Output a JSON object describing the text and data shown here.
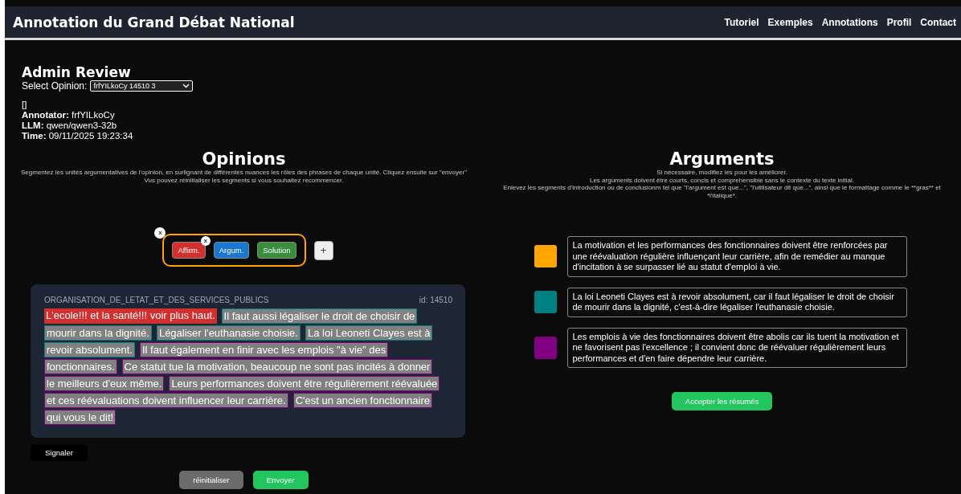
{
  "header": {
    "title": "Annotation du Grand Débat National",
    "nav": [
      "Tutoriel",
      "Exemples",
      "Annotations",
      "Profil",
      "Contact"
    ]
  },
  "review": {
    "title": "Admin Review",
    "select_label": "Select Opinion:",
    "select_value": "frfYILkoCy 14510 3",
    "raw": "[]",
    "meta": [
      {
        "label": "Annotator:",
        "value": "frfYILkoCy"
      },
      {
        "label": "LLM:",
        "value": "qwen/qwen3-32b"
      },
      {
        "label": "Time:",
        "value": "09/11/2025 19:23:34"
      }
    ]
  },
  "opinions": {
    "title": "Opinions",
    "instructions": [
      "Segmentez les unités argumentatives de l'opinion, en surlignant de différentes nuances les rôles des phrases de chaque unité. Cliquez ensuite sur \"envoyer\"",
      "Vus pouvez réinitialiser les segments si vous souhaitez recommencer."
    ],
    "group_remove": "x",
    "chips": [
      {
        "label": "Affirm.",
        "color": "#d32f2f",
        "remove": "x"
      },
      {
        "label": "Argum.",
        "color": "#1976d2"
      },
      {
        "label": "Solution",
        "color": "#388e3c"
      }
    ],
    "add": "+",
    "card": {
      "category": "ORGANISATION_DE_LETAT_ET_DES_SERVICES_PUBLICS",
      "id": "id: 14510",
      "segments": [
        {
          "lines": [
            "L'ecole!!! et la santé!!! voir plus haut."
          ],
          "kind": "filled",
          "color": "#d32f2f"
        },
        {
          "lines": [
            "Il faut aussi légaliser le droit de choisir de",
            "mourir dans la dignité."
          ],
          "kind": "outlined",
          "color": "#008080"
        },
        {
          "lines": [
            "Légaliser l'euthanasie choisie."
          ],
          "kind": "outlined",
          "color": "#008080"
        },
        {
          "lines": [
            "La loi Leoneti Clayes est à",
            "revoir absolument."
          ],
          "kind": "outlined",
          "color": "#008080"
        },
        {
          "lines": [
            "Il faut également en finir avec les emplois \"à vie\" des",
            "fonctionnaires."
          ],
          "kind": "outlined",
          "color": "#800080"
        },
        {
          "lines": [
            "Ce statut tue la motivation, beaucoup ne sont pas incités à donner",
            "le meilleurs d'eux même."
          ],
          "kind": "outlined",
          "color": "#800080"
        },
        {
          "lines": [
            "Leurs performances doivent être régulièrement réévaluée",
            "et ces réévaluations doivent influencer leur carrière."
          ],
          "kind": "outlined",
          "color": "#800080"
        },
        {
          "lines": [
            "C'est un ancien fonctionnaire",
            "qui vous le dit!"
          ],
          "kind": "outlined",
          "color": "#800080"
        }
      ]
    },
    "report": "Signaler",
    "reset": "réinitialiser",
    "send": "Envoyer"
  },
  "arguments": {
    "title": "Arguments",
    "instructions": [
      "Si nécessaire, modifiez les pour les améliorer.",
      "Les arguments doivent être courts, concis et comprehensible sans le contexte du texte initial.",
      "Enlevez les segments d'introduction ou de conclusionm tel que \"l'argument est que...\", \"l'utilisateur dit que...\", ainsi que le formattage comme le **gras** et *l'italique*."
    ],
    "items": [
      {
        "color": "#ffa500",
        "text": "La motivation et les performances des fonctionnaires doivent être renforcées par une réévaluation régulière influençant leur carrière, afin de remédier au manque d'incitation à se surpasser lié au statut d'emploi à vie."
      },
      {
        "color": "#008080",
        "text": "La loi Leoneti Clayes est à revoir absolument, car il faut légaliser le droit de choisir de mourir dans la dignité, c'est-à-dire légaliser l'euthanasie choisie."
      },
      {
        "color": "#800080",
        "text": "Les emplois à vie des fonctionnaires doivent être abolis car ils tuent la motivation et ne favorisent pas l'excellence ; il convient donc de réévaluer régulièrement leurs performances et d'en faire dépendre leur carrière."
      }
    ],
    "accept": "Accepter les résumés"
  }
}
